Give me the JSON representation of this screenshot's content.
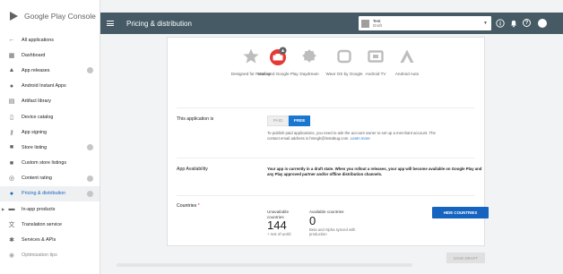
{
  "brand": {
    "logo_text": "Google Play Console"
  },
  "topbar": {
    "title": "Pricing & distribution"
  },
  "app_selector": {
    "name": "Test",
    "status": "Draft"
  },
  "sidebar": {
    "items": [
      {
        "label": "All applications",
        "icon": "arrow-left-icon"
      },
      {
        "label": "Dashboard",
        "icon": "dashboard-icon"
      },
      {
        "label": "App releases",
        "icon": "rocket-icon",
        "check": true
      },
      {
        "label": "Android Instant Apps",
        "icon": "instant-app-icon"
      },
      {
        "label": "Artifact library",
        "icon": "library-icon"
      },
      {
        "label": "Device catalog",
        "icon": "device-icon"
      },
      {
        "label": "App signing",
        "icon": "key-icon"
      },
      {
        "label": "Store listing",
        "icon": "store-icon",
        "check": true
      },
      {
        "label": "Custom store listings",
        "icon": "custom-store-icon"
      },
      {
        "label": "Content rating",
        "icon": "rating-icon",
        "check": true
      },
      {
        "label": "Pricing & distribution",
        "icon": "globe-icon",
        "active": true,
        "check": true
      },
      {
        "label": "In-app products",
        "icon": "card-icon",
        "caret": true
      },
      {
        "label": "Translation service",
        "icon": "translate-icon"
      },
      {
        "label": "Services & APIs",
        "icon": "services-icon"
      },
      {
        "label": "Optimization tips",
        "icon": "bulb-icon",
        "clipped": true
      }
    ]
  },
  "devices": [
    {
      "label": "Designed for Families",
      "icon": "families-star-icon"
    },
    {
      "label": "Managed Google Play",
      "icon": "managed-play-icon"
    },
    {
      "label": "Daydream",
      "icon": "daydream-icon"
    },
    {
      "label": "Wear OS by Google",
      "icon": "wear-os-icon"
    },
    {
      "label": "Android TV",
      "icon": "android-tv-icon"
    },
    {
      "label": "Android Auto",
      "icon": "android-auto-icon"
    }
  ],
  "pricing": {
    "label": "This application is",
    "paid": "PAID",
    "free": "FREE",
    "note": "To publish paid applications, you need to ask the account owner to set up a merchant account. The contact email address is hmegh@instabug.com.",
    "learn_more": "Learn more"
  },
  "availability": {
    "label": "App Availability",
    "text": "Your app is currently in a draft state. When you rollout a releases, your app will become available on Google Play and any Play approved partner and/or offline distribution channels."
  },
  "countries": {
    "label": "Countries",
    "required_mark": "*",
    "unavailable_label": "Unavailable countries",
    "unavailable_count": "144",
    "unavailable_sub": "+ rest of world",
    "available_label": "Available countries",
    "available_count": "0",
    "available_sub": "Beta and Alpha synced with production",
    "hide_button": "HIDE COUNTRIES"
  },
  "footer": {
    "save_draft": "SAVE DRAFT"
  },
  "colors": {
    "topbar": "#455a64",
    "accent": "#1976d2",
    "active_nav": "#1565c0",
    "managed_play": "#e53935"
  }
}
